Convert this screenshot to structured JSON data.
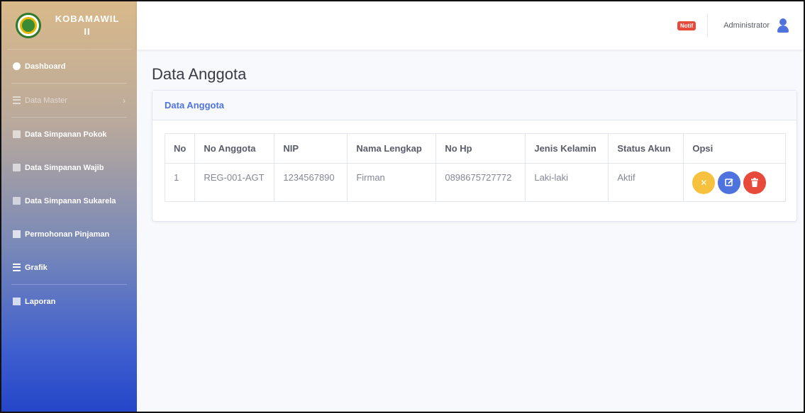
{
  "brand": {
    "line1": "KOBAMAWIL",
    "line2": "II"
  },
  "sidebar": {
    "items": [
      {
        "label": "Dashboard"
      },
      {
        "label": "Data Master"
      },
      {
        "label": "Data Simpanan Pokok"
      },
      {
        "label": "Data Simpanan Wajib"
      },
      {
        "label": "Data Simpanan Sukarela"
      },
      {
        "label": "Permohonan Pinjaman"
      },
      {
        "label": "Grafik"
      },
      {
        "label": "Laporan"
      }
    ]
  },
  "topbar": {
    "notif_label": "Notif",
    "user_name": "Administrator"
  },
  "page": {
    "title": "Data Anggota"
  },
  "card": {
    "title": "Data Anggota"
  },
  "table": {
    "headers": [
      "No",
      "No Anggota",
      "NIP",
      "Nama Lengkap",
      "No Hp",
      "Jenis Kelamin",
      "Status Akun",
      "Opsi"
    ],
    "rows": [
      [
        "1",
        "REG-001-AGT",
        "1234567890",
        "Firman",
        "0898675727772",
        "Laki-laki",
        "Aktif"
      ]
    ]
  },
  "colors": {
    "primary": "#4e73df",
    "warning": "#f6c23e",
    "danger": "#e74a3b"
  },
  "icons": {
    "opsi": [
      "close-icon",
      "edit-icon",
      "trash-icon"
    ]
  }
}
